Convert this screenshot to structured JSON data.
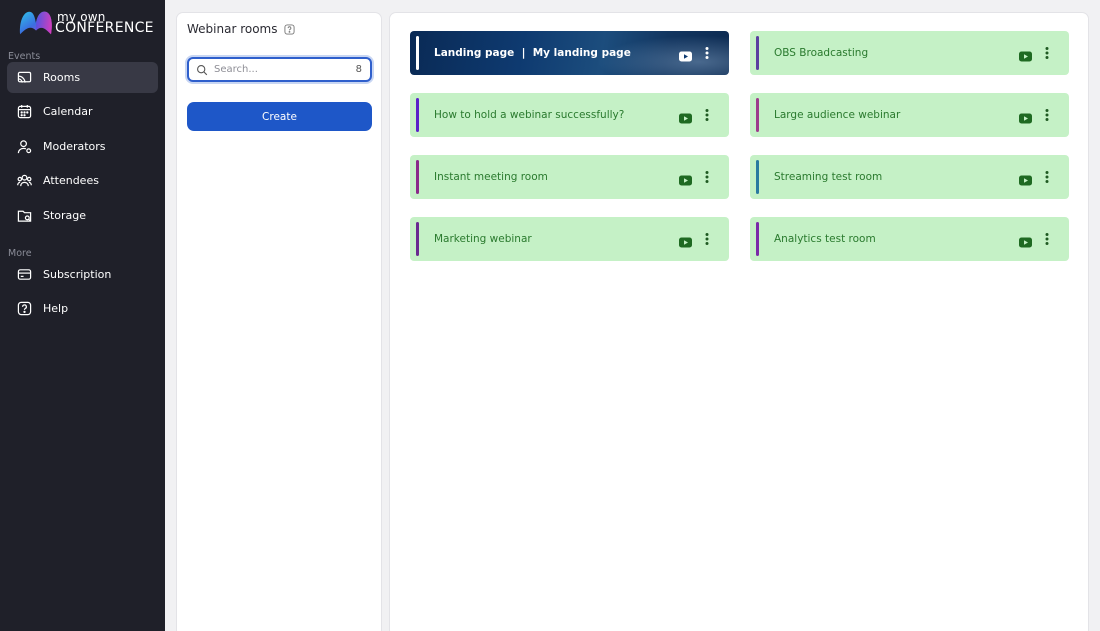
{
  "app": {
    "logo_small": "my own",
    "logo_big": "CONFERENCE"
  },
  "sidebar": {
    "events_label": "Events",
    "more_label": "More",
    "items": [
      {
        "label": "Rooms",
        "icon": "cast-icon",
        "active": true
      },
      {
        "label": "Calendar",
        "icon": "calendar-icon",
        "active": false
      },
      {
        "label": "Moderators",
        "icon": "moderator-icon",
        "active": false
      },
      {
        "label": "Attendees",
        "icon": "attendees-icon",
        "active": false
      },
      {
        "label": "Storage",
        "icon": "storage-icon",
        "active": false
      }
    ],
    "more_items": [
      {
        "label": "Subscription",
        "icon": "card-icon"
      },
      {
        "label": "Help",
        "icon": "help-icon"
      }
    ]
  },
  "rooms_panel": {
    "title": "Webinar rooms",
    "search_placeholder": "Search...",
    "search_count": "8",
    "create_label": "Create"
  },
  "rooms": [
    {
      "name": "Landing page  |  My landing page",
      "accent": "#ffffff",
      "type": "landing"
    },
    {
      "name": "OBS Broadcasting",
      "accent": "#5b3fa0"
    },
    {
      "name": "How to hold a webinar successfully?",
      "accent": "#5a22c8"
    },
    {
      "name": "Large audience webinar",
      "accent": "#9c3c8c"
    },
    {
      "name": "Instant meeting room",
      "accent": "#8a2a8a"
    },
    {
      "name": "Streaming test room",
      "accent": "#2a7aa0"
    },
    {
      "name": "Marketing webinar",
      "accent": "#6a2a90"
    },
    {
      "name": "Analytics test room",
      "accent": "#7a2aa8"
    }
  ],
  "colors": {
    "sidebar_bg": "#1f2029",
    "card_bg": "#c5f1c6",
    "card_text": "#2a7a2e",
    "primary": "#1e57c8"
  }
}
